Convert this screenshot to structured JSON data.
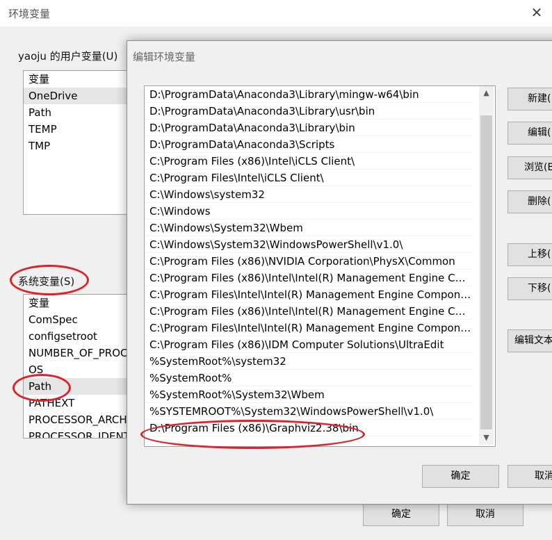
{
  "background_dialog": {
    "title": "环境变量",
    "close_glyph": "✕",
    "user_vars": {
      "label": "yaoju 的用户变量(U)",
      "header": "变量",
      "items": [
        "OneDrive",
        "Path",
        "TEMP",
        "TMP"
      ]
    },
    "system_vars": {
      "label": "系统变量(S)",
      "header": "变量",
      "items": [
        "ComSpec",
        "configsetroot",
        "NUMBER_OF_PROC",
        "OS",
        "Path",
        "PATHEXT",
        "PROCESSOR_ARCHI",
        "PROCESSOR_IDENTI"
      ]
    },
    "ok_label": "确定",
    "cancel_label": "取消"
  },
  "edit_dialog": {
    "title": "编辑环境变量",
    "paths": [
      "D:\\ProgramData\\Anaconda3\\Library\\mingw-w64\\bin",
      "D:\\ProgramData\\Anaconda3\\Library\\usr\\bin",
      "D:\\ProgramData\\Anaconda3\\Library\\bin",
      "D:\\ProgramData\\Anaconda3\\Scripts",
      "C:\\Program Files (x86)\\Intel\\iCLS Client\\",
      "C:\\Program Files\\Intel\\iCLS Client\\",
      "C:\\Windows\\system32",
      "C:\\Windows",
      "C:\\Windows\\System32\\Wbem",
      "C:\\Windows\\System32\\WindowsPowerShell\\v1.0\\",
      "C:\\Program Files (x86)\\NVIDIA Corporation\\PhysX\\Common",
      "C:\\Program Files (x86)\\Intel\\Intel(R) Management Engine Comp...",
      "C:\\Program Files\\Intel\\Intel(R) Management Engine Componen...",
      "C:\\Program Files (x86)\\Intel\\Intel(R) Management Engine Comp...",
      "C:\\Program Files\\Intel\\Intel(R) Management Engine Componen...",
      "C:\\Program Files (x86)\\IDM Computer Solutions\\UltraEdit",
      "%SystemRoot%\\system32",
      "%SystemRoot%",
      "%SystemRoot%\\System32\\Wbem",
      "%SYSTEMROOT%\\System32\\WindowsPowerShell\\v1.0\\",
      "D:\\Program Files (x86)\\Graphviz2.38\\bin"
    ],
    "buttons": {
      "new": "新建(",
      "edit": "编辑(",
      "browse": "浏览(B",
      "delete": "删除(",
      "move_up": "上移(",
      "move_down": "下移(",
      "edit_text": "编辑文本"
    },
    "ok_label": "确定",
    "cancel_label": "取消"
  },
  "annotation_color": "#e0202a"
}
